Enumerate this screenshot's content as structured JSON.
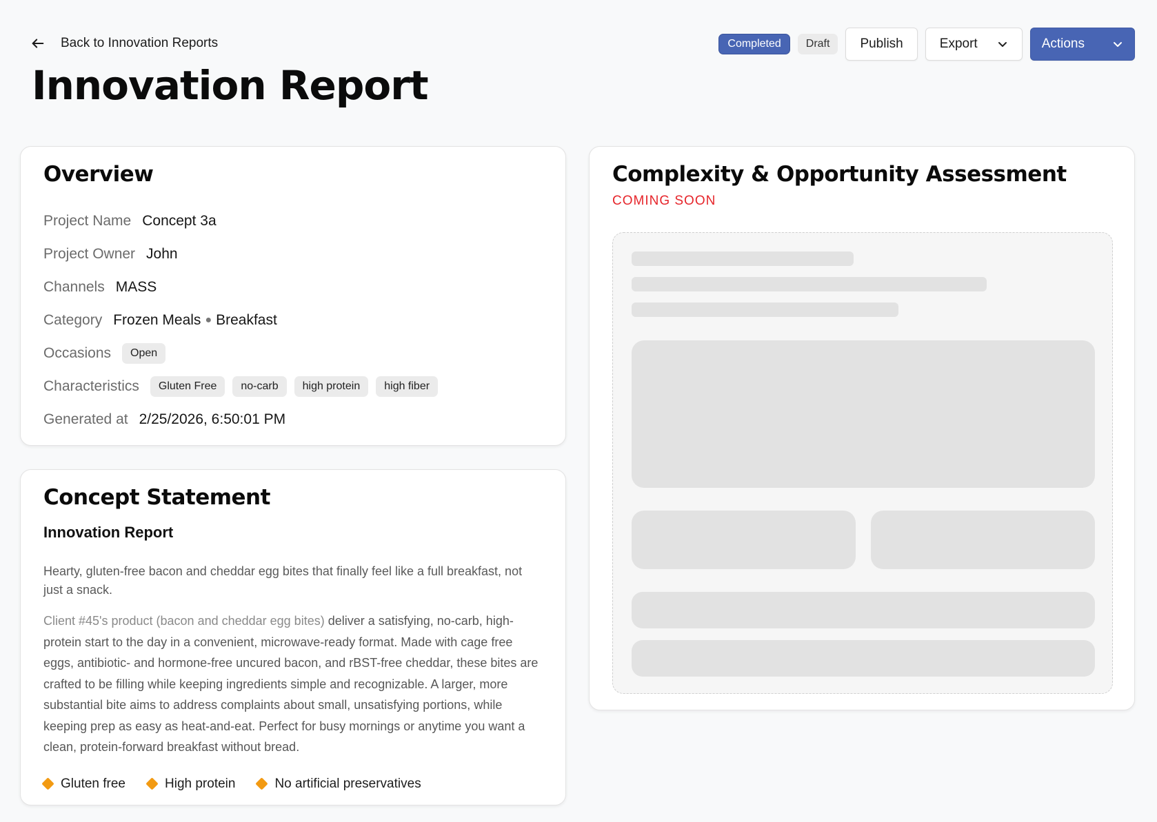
{
  "header": {
    "back_label": "Back to Innovation Reports",
    "title": "Innovation Report",
    "status_completed": "Completed",
    "status_draft": "Draft",
    "publish_label": "Publish",
    "export_label": "Export",
    "actions_label": "Actions"
  },
  "overview": {
    "title": "Overview",
    "project_name_label": "Project Name",
    "project_name": "Concept 3a",
    "project_owner_label": "Project Owner",
    "project_owner": "John",
    "channels_label": "Channels",
    "channels": "MASS",
    "category_label": "Category",
    "category": [
      "Frozen Meals",
      "Breakfast"
    ],
    "occasions_label": "Occasions",
    "occasions": [
      "Open"
    ],
    "characteristics_label": "Characteristics",
    "characteristics": [
      "Gluten Free",
      "no-carb",
      "high protein",
      "high fiber"
    ],
    "generated_label": "Generated at",
    "generated_at": "2/25/2026, 6:50:01 PM"
  },
  "concept": {
    "title": "Concept Statement",
    "subtitle": "Innovation Report",
    "lead": "Hearty, gluten-free bacon and cheddar egg bites that finally feel like a full breakfast, not just a snack.",
    "client": "Client #45's product (bacon and cheddar egg bites)",
    "body": " deliver a satisfying, no-carb, high-protein start to the day in a convenient, microwave-ready format. Made with cage free eggs, antibiotic- and hormone-free uncured bacon, and rBST-free cheddar, these bites are crafted to be filling while keeping ingredients simple and recognizable. A larger, more substantial bite aims to address complaints about small, unsatisfying portions, while keeping prep as easy as heat-and-eat. Perfect for busy mornings or anytime you want a clean, protein-forward breakfast without bread.",
    "highlights": [
      "Gluten free",
      "High protein",
      "No artificial preservatives"
    ]
  },
  "assessment": {
    "title": "Complexity & Opportunity Assessment",
    "status": "COMING SOON"
  },
  "colors": {
    "primary": "#4865b4",
    "coming_soon": "#e6252b",
    "highlight_diamond": "#f29a12"
  }
}
